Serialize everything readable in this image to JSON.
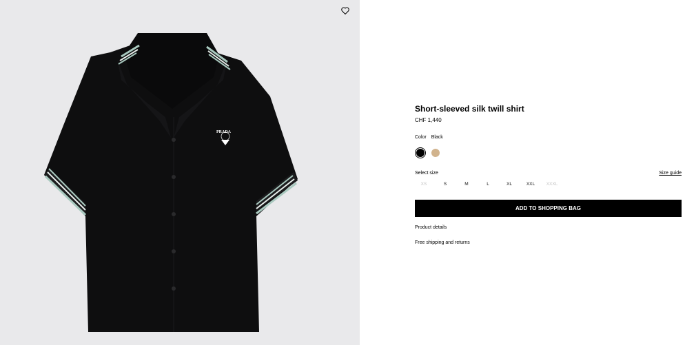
{
  "product": {
    "title": "Short-sleeved silk twill shirt",
    "price": "CHF 1,440",
    "image_logo_text": "PRADA",
    "color_label": "Color",
    "color_selected": "Black",
    "colors": [
      {
        "name": "Black",
        "hex": "#000000",
        "selected": true
      },
      {
        "name": "Beige",
        "hex": "#d1b38d",
        "selected": false
      }
    ],
    "select_size_label": "Select size",
    "size_guide_label": "Size guide",
    "sizes": [
      {
        "label": "XS",
        "available": false
      },
      {
        "label": "S",
        "available": true
      },
      {
        "label": "M",
        "available": true
      },
      {
        "label": "L",
        "available": true
      },
      {
        "label": "XL",
        "available": true
      },
      {
        "label": "XXL",
        "available": true
      },
      {
        "label": "XXXL",
        "available": false
      }
    ],
    "add_to_bag_label": "ADD TO SHOPPING BAG",
    "details_label": "Product details",
    "shipping_label": "Free shipping and returns"
  },
  "icons": {
    "wishlist": "heart-icon"
  },
  "colors": {
    "image_background": "#e9e9eb",
    "shirt": "#0e0e0f",
    "stripe_mint": "#a9c9bf",
    "button_bg": "#000000"
  }
}
